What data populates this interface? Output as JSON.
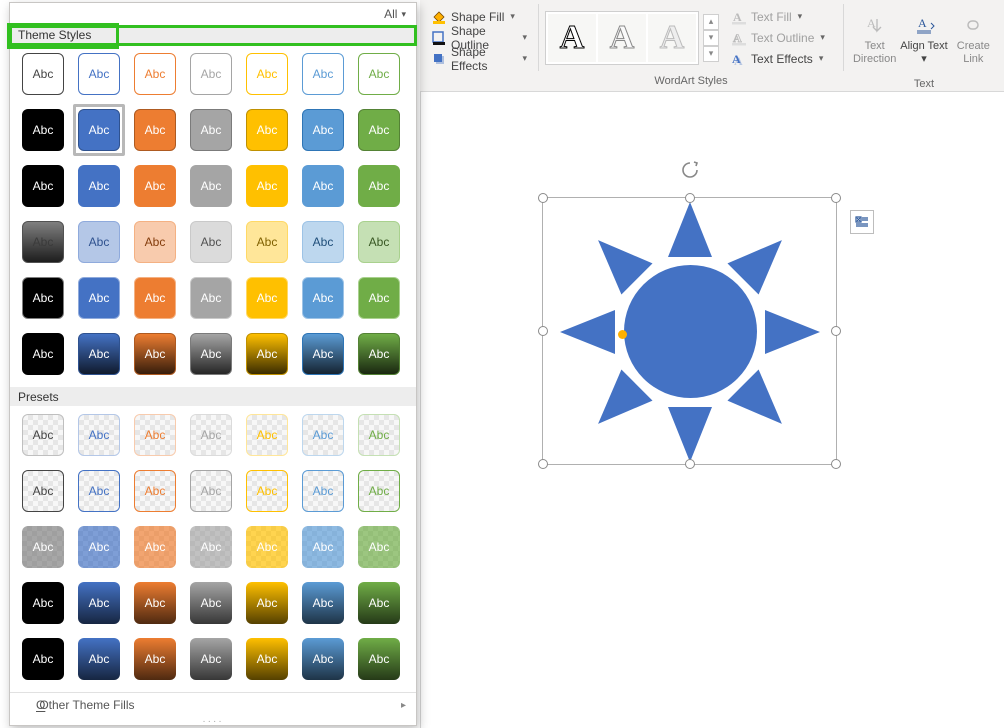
{
  "ribbon": {
    "shape_group": {
      "fill": "Shape Fill",
      "outline": "Shape Outline",
      "effects": "Shape Effects"
    },
    "wordart_group": {
      "label": "WordArt Styles",
      "samples": [
        "A",
        "A",
        "A"
      ]
    },
    "text_group": {
      "fill": "Text Fill",
      "outline": "Text Outline",
      "effects": "Text Effects"
    },
    "big_buttons": {
      "direction": "Text Direction",
      "align": "Align Text",
      "link": "Create Link",
      "group_label": "Text"
    }
  },
  "panel": {
    "filter": "All",
    "theme_header": "Theme Styles",
    "presets_header": "Presets",
    "footer": "Other Theme Fills",
    "swatch_label": "Abc",
    "theme": {
      "selected_index": 8,
      "colors": [
        {
          "bg": "#ffffff",
          "fg": "#444444",
          "border": "#444444"
        },
        {
          "bg": "#ffffff",
          "fg": "#4472c4",
          "border": "#4472c4"
        },
        {
          "bg": "#ffffff",
          "fg": "#ed7d31",
          "border": "#ed7d31"
        },
        {
          "bg": "#ffffff",
          "fg": "#a5a5a5",
          "border": "#a5a5a5"
        },
        {
          "bg": "#ffffff",
          "fg": "#ffc000",
          "border": "#ffc000"
        },
        {
          "bg": "#ffffff",
          "fg": "#5b9bd5",
          "border": "#5b9bd5"
        },
        {
          "bg": "#ffffff",
          "fg": "#70ad47",
          "border": "#70ad47"
        },
        {
          "bg": "#000000",
          "fg": "#ffffff",
          "border": "#000000"
        },
        {
          "bg": "#4472c4",
          "fg": "#ffffff",
          "border": "#2f528f"
        },
        {
          "bg": "#ed7d31",
          "fg": "#ffffff",
          "border": "#ae5a21"
        },
        {
          "bg": "#a5a5a5",
          "fg": "#ffffff",
          "border": "#7b7b7b"
        },
        {
          "bg": "#ffc000",
          "fg": "#ffffff",
          "border": "#bf9000"
        },
        {
          "bg": "#5b9bd5",
          "fg": "#ffffff",
          "border": "#2e75b6"
        },
        {
          "bg": "#70ad47",
          "fg": "#ffffff",
          "border": "#548235"
        },
        {
          "bg": "#000000",
          "fg": "#ffffff",
          "border": "#000000"
        },
        {
          "bg": "#4472c4",
          "fg": "#ffffff",
          "border": "#4472c4"
        },
        {
          "bg": "#ed7d31",
          "fg": "#ffffff",
          "border": "#ed7d31"
        },
        {
          "bg": "#a5a5a5",
          "fg": "#ffffff",
          "border": "#a5a5a5"
        },
        {
          "bg": "#ffc000",
          "fg": "#ffffff",
          "border": "#ffc000"
        },
        {
          "bg": "#5b9bd5",
          "fg": "#ffffff",
          "border": "#5b9bd5"
        },
        {
          "bg": "#70ad47",
          "fg": "#ffffff",
          "border": "#70ad47"
        },
        {
          "bg": "#7f7f7f",
          "fg": "#3b3b3b",
          "border": "#525252",
          "grad": true
        },
        {
          "bg": "#b4c7e7",
          "fg": "#2f528f",
          "border": "#8faadc"
        },
        {
          "bg": "#f8cbad",
          "fg": "#843c0c",
          "border": "#f4b183"
        },
        {
          "bg": "#dbdbdb",
          "fg": "#525252",
          "border": "#c9c9c9"
        },
        {
          "bg": "#ffe699",
          "fg": "#7f6000",
          "border": "#ffd966"
        },
        {
          "bg": "#bdd7ee",
          "fg": "#1f4e79",
          "border": "#9dc3e6"
        },
        {
          "bg": "#c5e0b4",
          "fg": "#385723",
          "border": "#a9d18e"
        },
        {
          "bg": "#000000",
          "fg": "#ffffff",
          "border": "#7f7f7f"
        },
        {
          "bg": "#4472c4",
          "fg": "#ffffff",
          "border": "#8faadc"
        },
        {
          "bg": "#ed7d31",
          "fg": "#ffffff",
          "border": "#f4b183"
        },
        {
          "bg": "#a5a5a5",
          "fg": "#ffffff",
          "border": "#c9c9c9"
        },
        {
          "bg": "#ffc000",
          "fg": "#ffffff",
          "border": "#ffd966"
        },
        {
          "bg": "#5b9bd5",
          "fg": "#ffffff",
          "border": "#9dc3e6"
        },
        {
          "bg": "#70ad47",
          "fg": "#ffffff",
          "border": "#a9d18e"
        },
        {
          "bg": "#000000",
          "fg": "#ffffff",
          "border": "#000000",
          "grad": true
        },
        {
          "bg": "#4472c4",
          "fg": "#ffffff",
          "border": "#2f528f",
          "grad": true
        },
        {
          "bg": "#ed7d31",
          "fg": "#ffffff",
          "border": "#ae5a21",
          "grad": true
        },
        {
          "bg": "#a5a5a5",
          "fg": "#ffffff",
          "border": "#7b7b7b",
          "grad": true
        },
        {
          "bg": "#ffc000",
          "fg": "#ffffff",
          "border": "#bf9000",
          "grad": true
        },
        {
          "bg": "#5b9bd5",
          "fg": "#ffffff",
          "border": "#2e75b6",
          "grad": true
        },
        {
          "bg": "#70ad47",
          "fg": "#ffffff",
          "border": "#548235",
          "grad": true
        }
      ]
    },
    "presets": {
      "colors": [
        {
          "fg": "#444444",
          "border": "#bfbfbf"
        },
        {
          "fg": "#4472c4",
          "border": "#b4c7e7"
        },
        {
          "fg": "#ed7d31",
          "border": "#f8cbad"
        },
        {
          "fg": "#a5a5a5",
          "border": "#dbdbdb"
        },
        {
          "fg": "#ffc000",
          "border": "#ffe699"
        },
        {
          "fg": "#5b9bd5",
          "border": "#bdd7ee"
        },
        {
          "fg": "#70ad47",
          "border": "#c5e0b4"
        },
        {
          "fg": "#444444",
          "border": "#444444"
        },
        {
          "fg": "#4472c4",
          "border": "#4472c4"
        },
        {
          "fg": "#ed7d31",
          "border": "#ed7d31"
        },
        {
          "fg": "#a5a5a5",
          "border": "#a5a5a5"
        },
        {
          "fg": "#ffc000",
          "border": "#ffc000"
        },
        {
          "fg": "#5b9bd5",
          "border": "#5b9bd5"
        },
        {
          "fg": "#70ad47",
          "border": "#70ad47"
        },
        {
          "bg": "#7f7f7f",
          "fg": "#ffffff",
          "tint": 0.55
        },
        {
          "bg": "#4472c4",
          "fg": "#ffffff",
          "tint": 0.55
        },
        {
          "bg": "#ed7d31",
          "fg": "#ffffff",
          "tint": 0.55
        },
        {
          "bg": "#a5a5a5",
          "fg": "#ffffff",
          "tint": 0.55
        },
        {
          "bg": "#ffc000",
          "fg": "#ffffff",
          "tint": 0.55
        },
        {
          "bg": "#5b9bd5",
          "fg": "#ffffff",
          "tint": 0.55
        },
        {
          "bg": "#70ad47",
          "fg": "#ffffff",
          "tint": 0.55
        },
        {
          "bg": "#000000",
          "fg": "#ffffff",
          "grad": true
        },
        {
          "bg": "#4472c4",
          "fg": "#ffffff",
          "grad": true
        },
        {
          "bg": "#ed7d31",
          "fg": "#ffffff",
          "grad": true
        },
        {
          "bg": "#a5a5a5",
          "fg": "#ffffff",
          "grad": true
        },
        {
          "bg": "#ffc000",
          "fg": "#ffffff",
          "grad": true
        },
        {
          "bg": "#5b9bd5",
          "fg": "#ffffff",
          "grad": true
        },
        {
          "bg": "#70ad47",
          "fg": "#ffffff",
          "grad": true
        },
        {
          "bg": "#000000",
          "fg": "#ffffff",
          "grad": true
        },
        {
          "bg": "#4472c4",
          "fg": "#ffffff",
          "grad": true
        },
        {
          "bg": "#ed7d31",
          "fg": "#ffffff",
          "grad": true
        },
        {
          "bg": "#a5a5a5",
          "fg": "#ffffff",
          "grad": true
        },
        {
          "bg": "#ffc000",
          "fg": "#ffffff",
          "grad": true
        },
        {
          "bg": "#5b9bd5",
          "fg": "#ffffff",
          "grad": true
        },
        {
          "bg": "#70ad47",
          "fg": "#ffffff",
          "grad": true
        }
      ]
    }
  },
  "canvas": {
    "shape": "sun",
    "fill_color": "#4472c4"
  }
}
